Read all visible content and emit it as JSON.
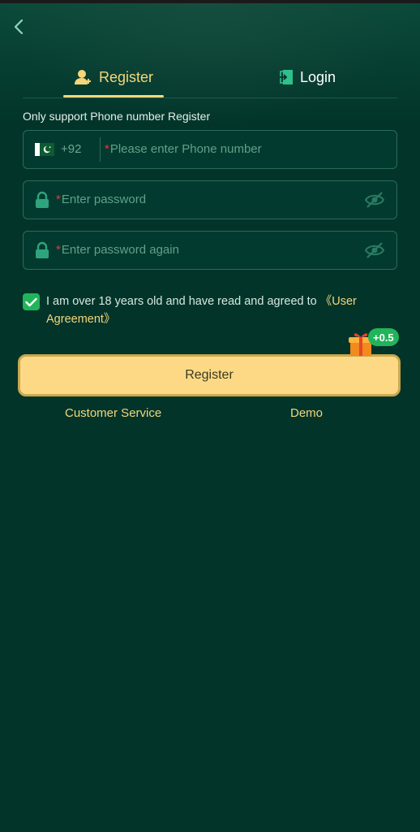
{
  "tabs": {
    "register_label": "Register",
    "login_label": "Login"
  },
  "form": {
    "note": "Only support Phone number Register",
    "phone": {
      "country_code": "+92",
      "required_mark": "*",
      "placeholder": "Please enter Phone number"
    },
    "password": {
      "required_mark": "*",
      "placeholder": "Enter password"
    },
    "password_again": {
      "required_mark": "*",
      "placeholder": "Enter password again"
    },
    "agreement": {
      "text": "I am over 18 years old and have read and agreed to ",
      "link": "《User Agreement》",
      "checked": true
    }
  },
  "register_button": {
    "label": "Register",
    "bonus": "+0.5"
  },
  "links": {
    "customer_service": "Customer Service",
    "demo": "Demo"
  },
  "icons": {
    "back": "chevron-left-icon",
    "register_tab": "add-user-icon",
    "login_tab": "login-door-icon",
    "flag": "pakistan-flag-icon",
    "lock": "lock-icon",
    "eye": "eye-off-icon",
    "check": "check-icon",
    "gift": "gift-icon"
  },
  "colors": {
    "background": "#02342a",
    "accent": "#f5d67a",
    "button": "#fed985",
    "success": "#22b45a",
    "required": "#e03b3b"
  }
}
